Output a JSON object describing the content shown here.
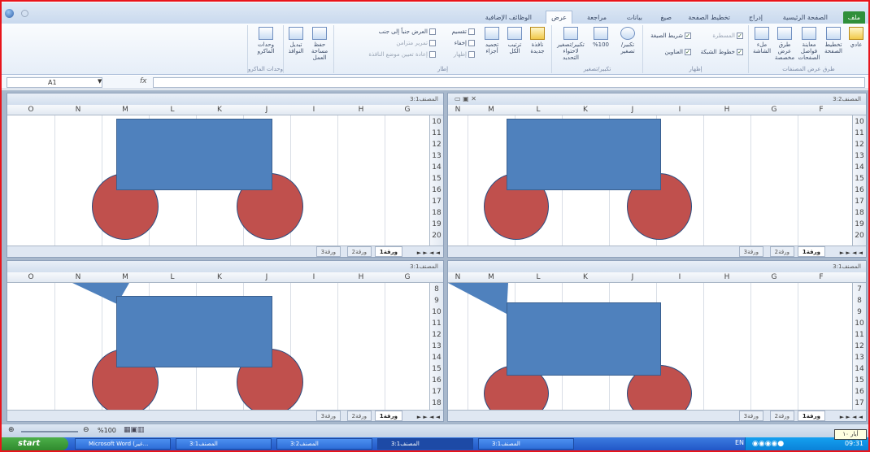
{
  "quick_access": {
    "app_icon": "excel-app-icon",
    "extra_icon": "circle-icon"
  },
  "tabs": [
    "ملف",
    "الصفحة الرئيسية",
    "إدراج",
    "تخطيط الصفحة",
    "صيغ",
    "بيانات",
    "مراجعة",
    "عرض",
    "الوظائف الإضافية"
  ],
  "ribbon": {
    "workbook_views": {
      "label": "طرق عرض المصنفات",
      "buttons": [
        "عادي",
        "تخطيط الصفحة",
        "معاينة فواصل الصفحات",
        "طرق عرض مخصصة",
        "ملء الشاشة"
      ]
    },
    "show": {
      "label": "إظهار",
      "items": [
        "المسطرة",
        "خطوط الشبكة",
        "شريط الصيغة",
        "العناوين"
      ]
    },
    "zoom": {
      "label": "تكبير/تصغير",
      "buttons": [
        "تكبير/تصغير",
        "%100",
        "تكبير/تصغير لاحتواء التحديد"
      ]
    },
    "window": {
      "label": "إطار",
      "buttons": [
        "نافذة جديدة",
        "ترتيب الكل",
        "تجميد أجزاء"
      ],
      "small": [
        "تقسيم",
        "إخفاء",
        "إظهار",
        "العرض جنباً إلى جنب",
        "تمرير متزامن",
        "إعادة تعيين موضع النافذة"
      ],
      "right_buttons": [
        "حفظ مساحة العمل",
        "تبديل النوافذ"
      ]
    },
    "macros": {
      "label": "وحدات الماكرو",
      "button": "وحدات الماكرو"
    }
  },
  "formula_bar": {
    "name_box": "A1",
    "fx": "fx",
    "value": ""
  },
  "panes": {
    "top_left": {
      "title": "المصنف3:1",
      "cols": [
        "O",
        "N",
        "M",
        "L",
        "K",
        "J",
        "I",
        "H",
        "G"
      ],
      "rows": [
        "10",
        "11",
        "12",
        "13",
        "14",
        "15",
        "16",
        "17",
        "18",
        "19",
        "20"
      ],
      "sheets": [
        "ورقة1",
        "ورقة2",
        "ورقة3"
      ]
    },
    "top_right": {
      "title": "المصنف3:2",
      "cols": [
        "N",
        "M",
        "L",
        "K",
        "J",
        "I",
        "H",
        "G",
        "F"
      ],
      "rows": [
        "10",
        "11",
        "12",
        "13",
        "14",
        "15",
        "16",
        "17",
        "18",
        "19",
        "20"
      ],
      "sheets": [
        "ورقة1",
        "ورقة2",
        "ورقة3"
      ]
    },
    "bottom_left": {
      "title": "المصنف3:1",
      "cols": [
        "O",
        "N",
        "M",
        "L",
        "K",
        "J",
        "I",
        "H",
        "G"
      ],
      "rows": [
        "8",
        "9",
        "10",
        "11",
        "12",
        "13",
        "14",
        "15",
        "16",
        "17",
        "18"
      ],
      "sheets": [
        "ورقة1",
        "ورقة2",
        "ورقة3"
      ]
    },
    "bottom_right": {
      "title": "المصنف3:1",
      "cols": [
        "N",
        "M",
        "L",
        "K",
        "J",
        "I",
        "H",
        "G",
        "F"
      ],
      "rows": [
        "7",
        "8",
        "9",
        "10",
        "11",
        "12",
        "13",
        "14",
        "15",
        "16",
        "17"
      ],
      "sheets": [
        "ورقة1",
        "ورقة2",
        "ورقة3"
      ]
    }
  },
  "status": {
    "zoom": "%100"
  },
  "taskbar": {
    "start": "start",
    "buttons": [
      "Microsoft Word (غير...",
      "المصنف3:1",
      "المصنف3:2",
      "المصنف3:1",
      "المصنف3:1"
    ],
    "lang": "EN",
    "clock": "09:31",
    "tooltip": "أيار ١٠"
  },
  "colors": {
    "shape_blue": "#4f81bd",
    "shape_red": "#c0504d",
    "file_tab": "#2f8f3a",
    "frame": "#e8141b"
  }
}
